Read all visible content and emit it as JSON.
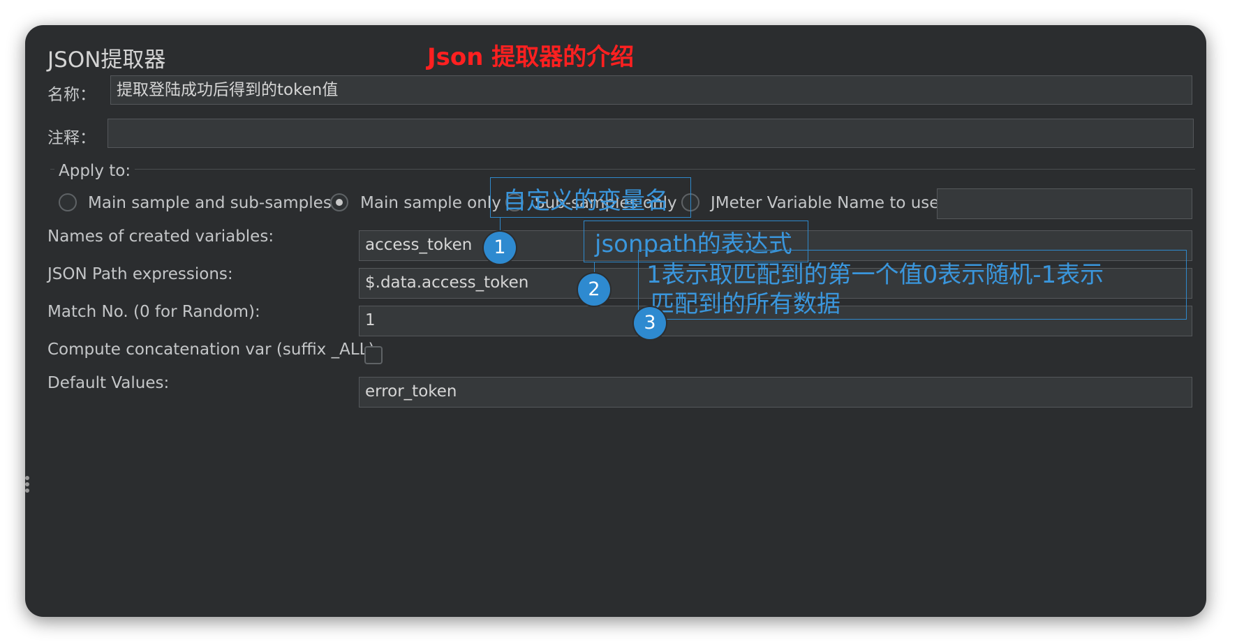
{
  "panel": {
    "title": "JSON提取器",
    "name_label": "名称：",
    "name_value": "提取登陆成功后得到的token值",
    "comment_label": "注释：",
    "comment_value": ""
  },
  "apply_to": {
    "legend": "Apply to:",
    "options": [
      {
        "label": "Main sample and sub-samples",
        "selected": false
      },
      {
        "label": "Main sample only",
        "selected": true
      },
      {
        "label": "Sub-samples only",
        "selected": false
      },
      {
        "label": "JMeter Variable Name to use",
        "selected": false
      }
    ],
    "variable_name_value": ""
  },
  "fields": {
    "variables_label": "Names of created variables:",
    "variables_value": "access_token",
    "jsonpath_label": "JSON Path expressions:",
    "jsonpath_value": "$.data.access_token",
    "match_label": "Match No. (0 for Random):",
    "match_value": "1",
    "concat_label": "Compute concatenation var (suffix _ALL):",
    "concat_checked": false,
    "default_label": "Default Values:",
    "default_value": "error_token"
  },
  "annotations": {
    "header": "Json 提取器的介绍",
    "note_1": "自定义的变量名",
    "note_2": "jsonpath的表达式",
    "note_3_line1": "1表示取匹配到的第一个值0表示随机-1表示",
    "note_3_line2": "匹配到的所有数据",
    "badge_1": "1",
    "badge_2": "2",
    "badge_3": "3"
  },
  "colors": {
    "panel_bg": "#2b2d2f",
    "annotation_blue": "#2e8ad0",
    "header_red": "#ff2020"
  }
}
